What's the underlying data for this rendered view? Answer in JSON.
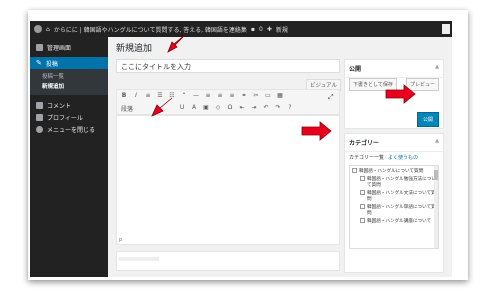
{
  "adminbar": {
    "site_label": "からにに | 韓国語やハングルについて質問する, 答える, 韓国語を連絡集",
    "comments_count": "0",
    "new_label": "新規"
  },
  "sidebar": {
    "dashboard_label": "管理画面",
    "posts_label": "投稿",
    "post_list_label": "投稿一覧",
    "new_post_label": "新規追加",
    "comments_label": "コメント",
    "profile_label": "プロフィール",
    "collapse_label": "メニューを閉じる"
  },
  "editor": {
    "page_title": "新規追加",
    "title_placeholder": "ここにタイトルを入力",
    "visual_tab": "ビジュアル",
    "format_select": "段落",
    "path_label": "p"
  },
  "publish": {
    "title": "公開",
    "save_draft": "下書きとして保存",
    "preview": "プレビュー",
    "publish_button": "公開"
  },
  "categories": {
    "title": "カテゴリー",
    "tab_all": "カテゴリー一覧",
    "tab_popular": "よく使うもの",
    "items": [
      {
        "label": "韓国語・ハングルについて質問",
        "child": false
      },
      {
        "label": "韓国語・ハングル勉強方法について質問",
        "child": true
      },
      {
        "label": "韓国語・ハングル文法について質問",
        "child": true
      },
      {
        "label": "韓国語・ハングル単語について質問",
        "child": true
      },
      {
        "label": "韓国語・ハングル講座について",
        "child": true
      }
    ]
  },
  "colors": {
    "arrow": "#e8001c",
    "accent": "#0073aa"
  }
}
